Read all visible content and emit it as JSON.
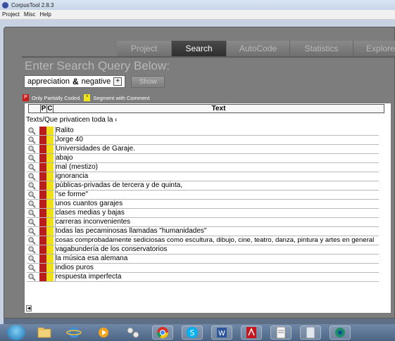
{
  "window": {
    "title": "CorpusTool 2.8.3"
  },
  "menu": [
    "Project",
    "Misc",
    "Help"
  ],
  "tabs": [
    {
      "label": "Project",
      "active": false
    },
    {
      "label": "Search",
      "active": true
    },
    {
      "label": "AutoCode",
      "active": false
    },
    {
      "label": "Statistics",
      "active": false
    },
    {
      "label": "Explore",
      "active": false
    }
  ],
  "search": {
    "heading": "Enter Search Query Below:",
    "term1": "appreciation",
    "operator": "&",
    "term2": "negative",
    "add_button": "+",
    "show_button": "Show"
  },
  "legend": {
    "partial_symbol": "P",
    "partial_label": "Only Partially Coded",
    "comment_symbol": "*",
    "comment_label": "Segment with Comment"
  },
  "table": {
    "col_p": "P",
    "col_c": "C",
    "col_text": "Text",
    "document": "Texts/Que privaticen toda la ‹",
    "rows": [
      "Ralito",
      "Jorge 40",
      "Universidades de Garaje.",
      "abajo",
      "mal (mestizo)",
      "ignorancia",
      "públicas-privadas de tercera y de quinta,",
      "\"se forme\"",
      "unos cuantos garajes",
      "clases medias y bajas",
      "carreras inconvenientes",
      "todas las pecaminosas llamadas \"humanidades\"",
      "cosas comprobadamente sediciosas como escultura, dibujo, cine, teatro, danza, pintura y artes en general",
      "vagabundería de los conservatorios",
      "la música esa alemana",
      "indios puros",
      "respuesta imperfecta"
    ]
  },
  "colors": {
    "partial_red": "#b71d1d",
    "comment_yellow": "#efe119",
    "active_tab": "#3a3a3a",
    "app_background": "#7d7d7d"
  },
  "taskbar": {
    "icons": [
      "start-orb-icon",
      "folder-icon",
      "internet-explorer-icon",
      "media-player-icon",
      "network-icon",
      "chrome-icon",
      "skype-icon",
      "word-icon",
      "acrobat-icon",
      "document-icon",
      "calculator-icon",
      "corpustool-icon"
    ]
  }
}
